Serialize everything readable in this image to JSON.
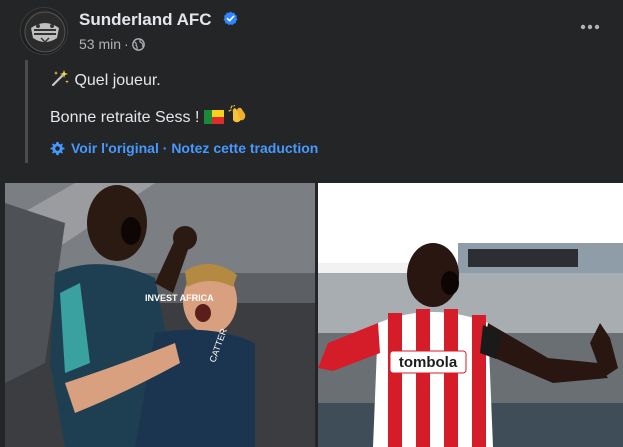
{
  "post": {
    "page_name": "Sunderland AFC",
    "time_ago": "53 min",
    "separator": "·",
    "audience_icon": "globe-icon",
    "verified_icon": "verified-badge-icon",
    "more_icon": "more-options-icon",
    "text_line1": "Quel joueur.",
    "text_line1_emoji": "sparkles-wand-emoji",
    "text_line2": "Bonne retraite Sess !",
    "text_line2_emojis": [
      "benin-flag-emoji",
      "clapping-hands-emoji"
    ],
    "see_original": "Voir l'original",
    "translate_separator": "·",
    "rate_translation": "Notez cette traduction"
  },
  "photos": {
    "left": {
      "alt": "player-celebration-photo-left",
      "sponsor_text": "INVEST AFRICA",
      "number_text": "CATTER"
    },
    "right": {
      "alt": "player-celebration-photo-right",
      "sponsor_text": "tombola"
    }
  },
  "colors": {
    "background": "#242526",
    "text": "#e4e6eb",
    "secondary_text": "#b0b3b8",
    "link": "#4599ff",
    "verified": "#2d88ff"
  }
}
